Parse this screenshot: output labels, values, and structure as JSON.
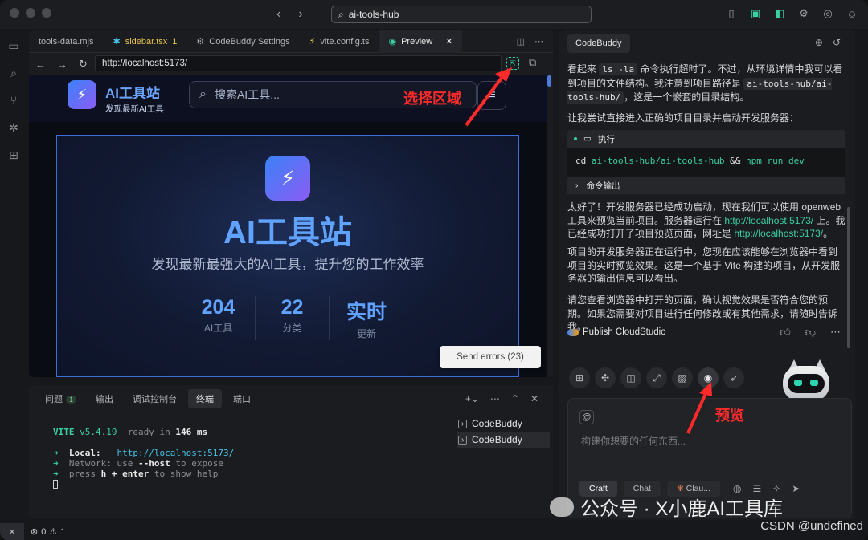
{
  "titlebar": {
    "search_value": "ai-tools-hub",
    "back": "‹",
    "forward": "›",
    "icons": [
      "sidebar-left-icon",
      "panel-bottom-icon",
      "sidebar-right-icon",
      "gear-icon",
      "browser-icon",
      "account-icon"
    ]
  },
  "activity_icons": [
    "files-icon",
    "search-icon",
    "source-control-icon",
    "debug-icon",
    "extensions-icon"
  ],
  "editor": {
    "tabs": [
      {
        "label": "tools-data.mjs",
        "icon": "",
        "active": false
      },
      {
        "label": "sidebar.tsx",
        "icon": "✱",
        "badge": "1",
        "active": false
      },
      {
        "label": "CodeBuddy Settings",
        "icon": "⚙",
        "active": false
      },
      {
        "label": "vite.config.ts",
        "icon": "⚡",
        "active": false
      },
      {
        "label": "Preview",
        "icon": "◉",
        "active": true
      }
    ],
    "close": "✕",
    "url": "http://localhost:5173/"
  },
  "site": {
    "brand_title": "AI工具站",
    "brand_subtitle": "发现最新AI工具",
    "search_placeholder": "搜索AI工具...",
    "hero_title": "AI工具站",
    "hero_subtitle": "发现最新最强大的AI工具，提升您的工作效率",
    "stats": [
      {
        "value": "204",
        "label": "AI工具"
      },
      {
        "value": "22",
        "label": "分类"
      },
      {
        "value": "实时",
        "label": "更新"
      }
    ],
    "send_errors": "Send errors (23)"
  },
  "annotations": {
    "select_area": "选择区域",
    "preview": "预览"
  },
  "terminal": {
    "tabs": [
      {
        "label": "问题",
        "badge": "1"
      },
      {
        "label": "输出"
      },
      {
        "label": "调试控制台"
      },
      {
        "label": "终端",
        "active": true
      },
      {
        "label": "端口"
      }
    ],
    "vite_name": "VITE",
    "vite_version": "v5.4.19",
    "ready_text": "ready in",
    "ready_ms": "146 ms",
    "local_label": "Local:",
    "local_url": "http://localhost:5173/",
    "network_label": "Network:",
    "network_text1": "use",
    "network_host": "--host",
    "network_text2": "to expose",
    "help_text1": "press",
    "help_key": "h + enter",
    "help_text2": "to show help",
    "list": [
      "CodeBuddy",
      "CodeBuddy"
    ]
  },
  "status": {
    "errors": "0",
    "warnings": "1",
    "csdn": "CSDN @undefined"
  },
  "chat": {
    "tab": "CodeBuddy",
    "p1_a": "看起来",
    "p1_code1": "ls -la",
    "p1_b": "命令执行超时了。不过，从环境详情中我可以看到项目的文件结构。我注意到项目路径是",
    "p1_code2": "ai-tools-hub/ai-tools-hub/",
    "p1_c": "，这是一个嵌套的目录结构。",
    "p2": "让我尝试直接进入正确的项目目录并启动开发服务器：",
    "exec_label": "执行",
    "exec_cmd_cd": "cd",
    "exec_cmd_path": "ai-tools-hub/ai-tools-hub",
    "exec_cmd_and": "&&",
    "exec_cmd_npm": "npm",
    "exec_cmd_rest": "run dev",
    "output_label": "命令输出",
    "p3_a": "太好了！开发服务器已经成功启动，现在我们可以使用 openweb 工具来预览当前项目。服务器运行在",
    "p3_link1": "http://localhost:5173/",
    "p3_b": "上。我已经成功打开了项目预览页面，网址是",
    "p3_link2": "http://localhost:5173/",
    "p3_c": "。",
    "p4": "项目的开发服务器正在运行中，您现在应该能够在浏览器中看到项目的实时预览效果。这是一个基于 Vite 构建的项目，从开发服务器的输出信息可以看出。",
    "p5": "请您查看浏览器中打开的页面，确认视觉效果是否符合您的预期。如果您需要对项目进行任何修改或有其他需求，请随时告诉我。",
    "publish": "Publish CloudStudio",
    "input_placeholder": "构建你想要的任何东西...",
    "modes": [
      "Craft",
      "Chat",
      "Clau..."
    ]
  },
  "watermark": "公众号 · X小鹿AI工具库"
}
